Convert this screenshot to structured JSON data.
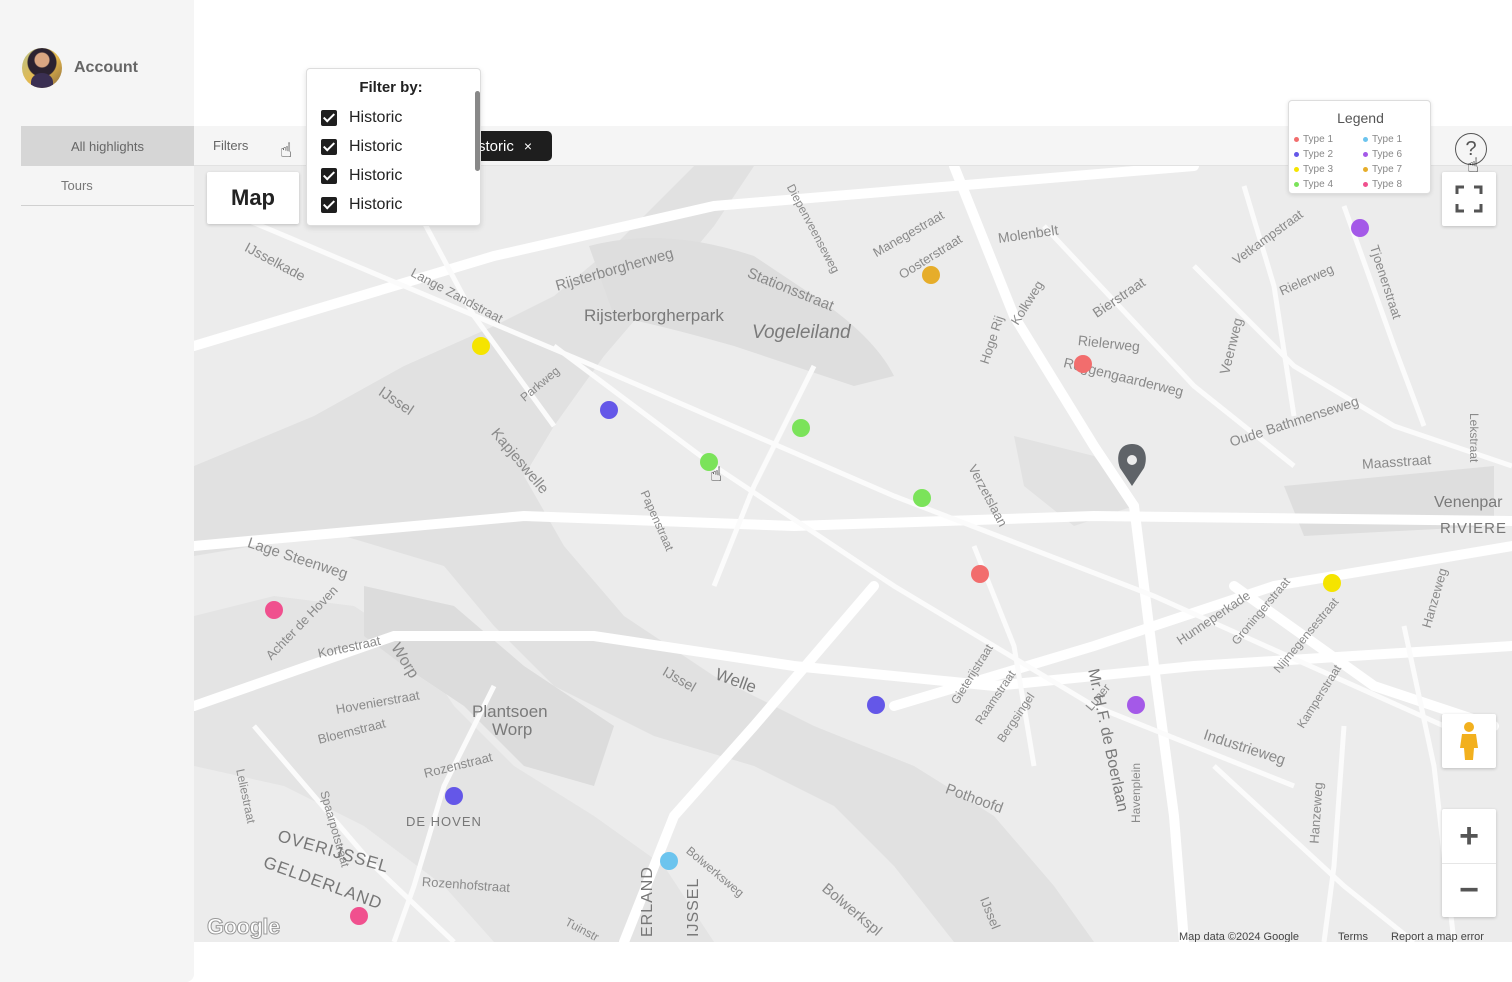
{
  "sidebar": {
    "account_label": "Account",
    "items": [
      {
        "label": "All highlights",
        "active": true
      },
      {
        "label": "Tours",
        "active": false
      }
    ]
  },
  "filterbar": {
    "filters_label": "Filters",
    "active_chip": "storic",
    "chip_close": "×"
  },
  "filter_dropdown": {
    "title": "Filter by:",
    "options": [
      {
        "label": "Historic",
        "checked": true
      },
      {
        "label": "Historic",
        "checked": true
      },
      {
        "label": "Historic",
        "checked": true
      },
      {
        "label": "Historic",
        "checked": true
      }
    ]
  },
  "legend": {
    "title": "Legend",
    "entries": [
      {
        "label": "Type 1",
        "color": "#f26d6d"
      },
      {
        "label": "Type 2",
        "color": "#6457e8"
      },
      {
        "label": "Type 3",
        "color": "#f5e400"
      },
      {
        "label": "Type 4",
        "color": "#7be35a"
      },
      {
        "label": "Type 1",
        "color": "#6cc4ee"
      },
      {
        "label": "Type 6",
        "color": "#a459e8"
      },
      {
        "label": "Type 7",
        "color": "#e6ad2a"
      },
      {
        "label": "Type 8",
        "color": "#f0508e"
      }
    ]
  },
  "map": {
    "view_label": "Map",
    "zoom_in": "+",
    "zoom_out": "−",
    "google_logo": "Google",
    "attribution": {
      "data": "Map data ©2024 Google",
      "terms": "Terms",
      "report": "Report a map error"
    },
    "streets": [
      "IJsselkade",
      "Lange Zandstraat",
      "Rijsterborgherweg",
      "Rijsterborgherpark",
      "Vogeleiland",
      "Stationsstraat",
      "Diepenveenseweg",
      "Manegestraat",
      "Oosterstraat",
      "Molenbelt",
      "Hoge Rij",
      "Kolkweg",
      "Bierstraat",
      "Vetkampstraat",
      "Rielerweg",
      "Rielerweg",
      "Tjoenerstraat",
      "Roggengaarderweg",
      "Veenweg",
      "Lekstraat",
      "IJssel",
      "Parkweg",
      "Kapjeswelle",
      "Papenstraat",
      "Verzetslaan",
      "Oude Bathmenseweg",
      "Maasstraat",
      "Venenpar",
      "RIVIERE",
      "Lage Steenweg",
      "Achter de Hoven",
      "Kortestraat",
      "Worp",
      "Plantsoen",
      "Worp",
      "Hovenierstraat",
      "Bloemstraat",
      "Leliestraat",
      "Spaarpotstraat",
      "Rozenstraat",
      "DE HOVEN",
      "OVERIJSSEL",
      "GELDERLAND",
      "Rozenhofstraat",
      "IJssel",
      "Welle",
      "Gieterijstraat",
      "Raamstraat",
      "Bergsingel",
      "Luner",
      "Mr. H.F. de Boerlaan",
      "Hunneperkade",
      "Groningerstraat",
      "Nijmegensestraat",
      "Kamperstraat",
      "Industrieweg",
      "Hanzeweg",
      "Pothoofd",
      "Havenplein",
      "Hanzeweg",
      "Bolwerksweg",
      "Bolwerkspl",
      "IJssel",
      "Tuinstr",
      "ERLAND",
      "IJSSEL"
    ],
    "markers": [
      {
        "type": "Type 3",
        "color": "#f5e400"
      },
      {
        "type": "Type 2",
        "color": "#6457e8"
      },
      {
        "type": "Type 4",
        "color": "#7be35a"
      },
      {
        "type": "Type 4",
        "color": "#7be35a"
      },
      {
        "type": "Type 4",
        "color": "#7be35a"
      },
      {
        "type": "Type 7",
        "color": "#e6ad2a"
      },
      {
        "type": "Type 1",
        "color": "#f26d6d"
      },
      {
        "type": "Type 6",
        "color": "#a459e8"
      },
      {
        "type": "Type 1",
        "color": "#f26d6d"
      },
      {
        "type": "Type 3",
        "color": "#f5e400"
      },
      {
        "type": "Type 8",
        "color": "#f0508e"
      },
      {
        "type": "Type 2",
        "color": "#6457e8"
      },
      {
        "type": "Type 6",
        "color": "#a459e8"
      },
      {
        "type": "Type 2",
        "color": "#6457e8"
      },
      {
        "type": "Type 1",
        "color": "#6cc4ee"
      },
      {
        "type": "Type 8",
        "color": "#f0508e"
      }
    ],
    "icons": [
      "map-pin-icon",
      "fullscreen-icon",
      "pegman-icon",
      "help-icon",
      "hand-cursor-icon"
    ]
  }
}
